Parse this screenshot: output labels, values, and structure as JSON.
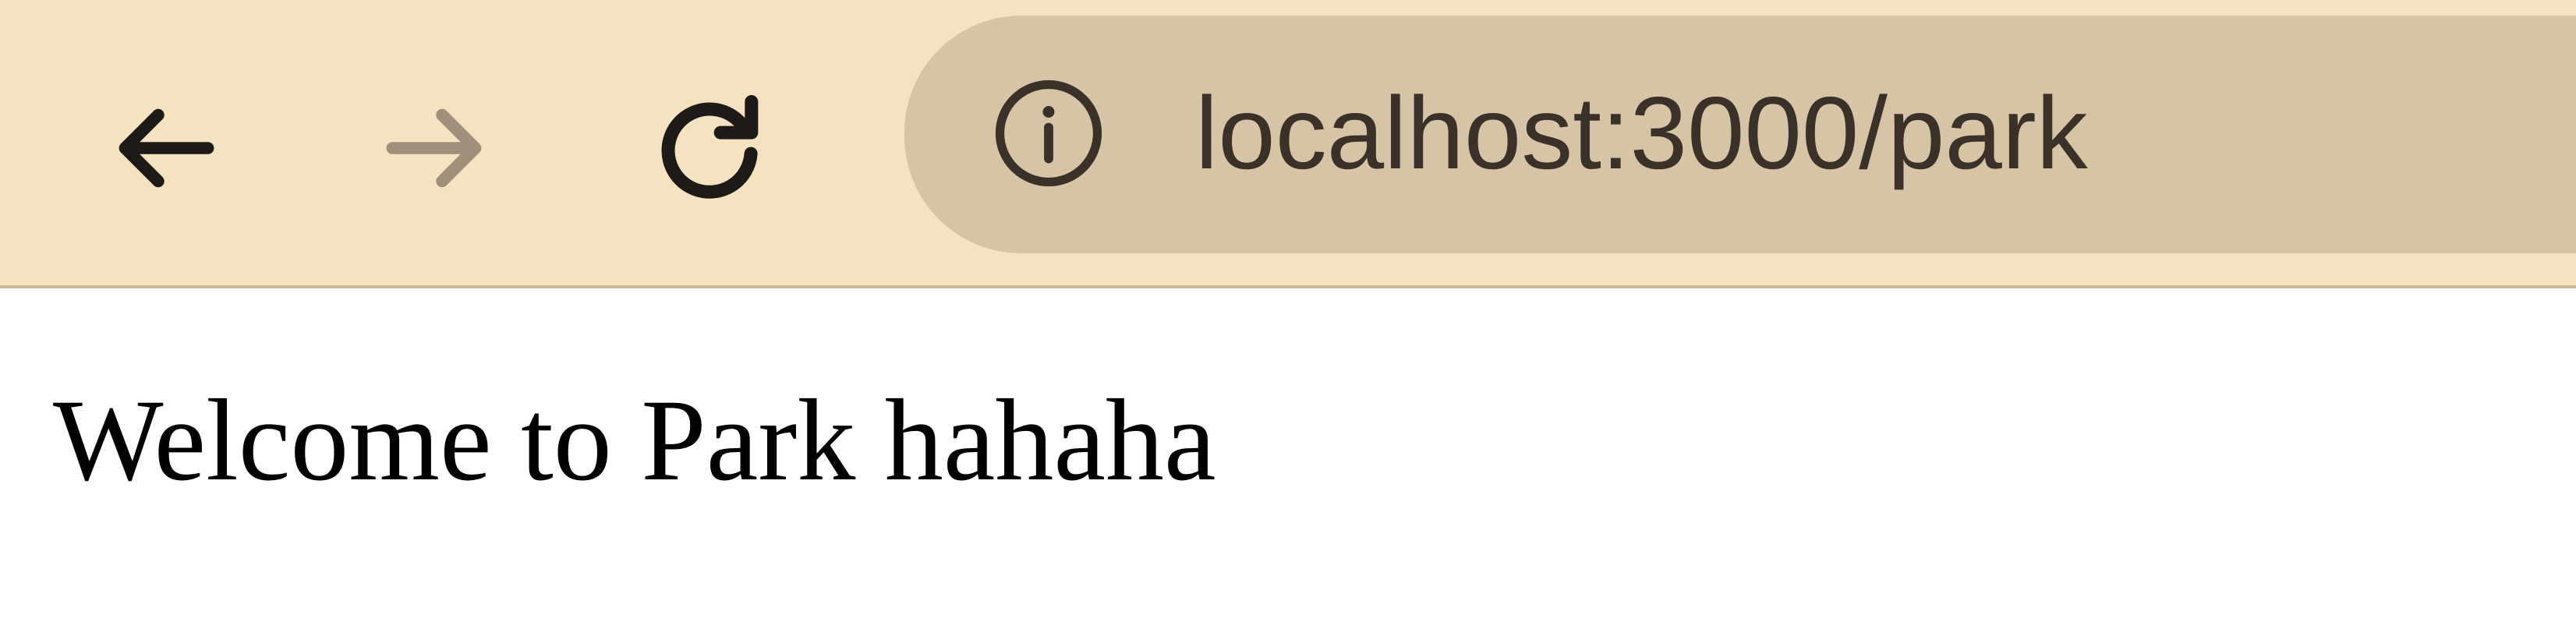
{
  "browser": {
    "toolbar": {
      "background": "#f4e2c0",
      "back_icon": "arrow-left-icon",
      "forward_icon": "arrow-right-icon",
      "reload_icon": "reload-icon",
      "forward_enabled": false
    },
    "address_bar": {
      "background": "#d7c4a6",
      "site_info_icon": "info-icon",
      "url": "localhost:3000/park"
    }
  },
  "page": {
    "body_text": "Welcome to Park hahaha"
  }
}
